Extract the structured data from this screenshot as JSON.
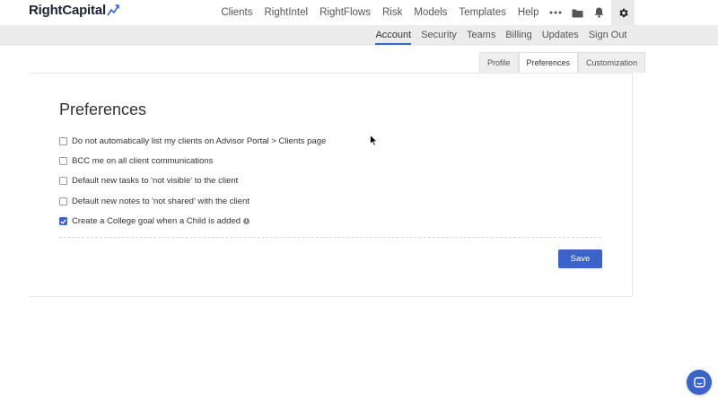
{
  "brand": {
    "name": "RightCapital"
  },
  "colors": {
    "accent": "#3c64c8",
    "subbar_bg": "#ececec"
  },
  "topnav": {
    "items": [
      "Clients",
      "RightIntel",
      "RightFlows",
      "Risk",
      "Models",
      "Templates",
      "Help"
    ],
    "icons": [
      "more-icon",
      "folder-icon",
      "bell-icon",
      "gear-icon"
    ]
  },
  "subnav": {
    "items": [
      "Account",
      "Security",
      "Teams",
      "Billing",
      "Updates",
      "Sign Out"
    ],
    "active": "Account"
  },
  "tabs": {
    "items": [
      "Profile",
      "Preferences",
      "Customization"
    ],
    "active": "Preferences"
  },
  "preferences": {
    "title": "Preferences",
    "options": [
      {
        "label": "Do not automatically list my clients on Advisor Portal > Clients page",
        "checked": false
      },
      {
        "label": "BCC me on all client communications",
        "checked": false
      },
      {
        "label": "Default new tasks to 'not visible' to the client",
        "checked": false
      },
      {
        "label": "Default new notes to 'not shared' with the client",
        "checked": false
      },
      {
        "label": "Create a College goal when a Child is added",
        "checked": true,
        "info_icon": true
      }
    ],
    "save_label": "Save"
  }
}
